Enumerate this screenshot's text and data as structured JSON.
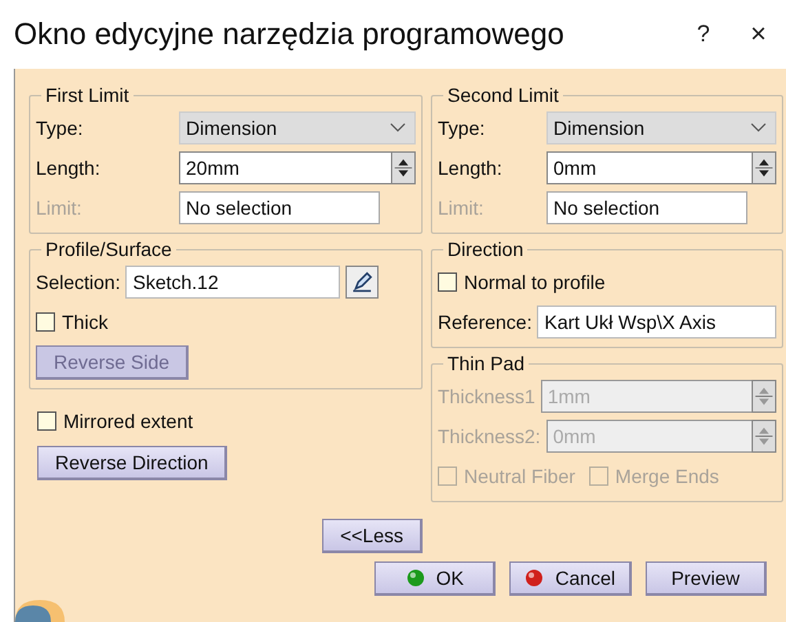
{
  "window": {
    "title": "Okno edycyjne narzędzia programowego",
    "help": "?",
    "close": "×"
  },
  "first_limit": {
    "title": "First Limit",
    "type_label": "Type:",
    "type_value": "Dimension",
    "length_label": "Length:",
    "length_value": "20mm",
    "limit_label": "Limit:",
    "limit_value": "No selection",
    "limit_disabled": true
  },
  "profile": {
    "title": "Profile/Surface",
    "selection_label": "Selection:",
    "selection_value": "Sketch.12",
    "thick": {
      "label": "Thick",
      "checked": false,
      "disabled": false
    },
    "reverse_side": {
      "label": "Reverse Side",
      "disabled": true
    }
  },
  "mirrored": {
    "label": "Mirrored extent",
    "checked": false,
    "disabled": false
  },
  "reverse_direction": {
    "label": "Reverse Direction",
    "disabled": false
  },
  "less": {
    "label": "<<Less"
  },
  "second_limit": {
    "title": "Second Limit",
    "type_label": "Type:",
    "type_value": "Dimension",
    "length_label": "Length:",
    "length_value": "0mm",
    "limit_label": "Limit:",
    "limit_value": "No selection",
    "limit_disabled": true
  },
  "direction": {
    "title": "Direction",
    "normal": {
      "label": "Normal to profile",
      "checked": false,
      "disabled": false
    },
    "reference_label": "Reference:",
    "reference_value": "Kart Ukł Wsp\\X Axis"
  },
  "thin_pad": {
    "title": "Thin Pad",
    "disabled": true,
    "thickness1_label": "Thickness1",
    "thickness1_value": "1mm",
    "thickness2_label": "Thickness2:",
    "thickness2_value": "0mm",
    "neutral": {
      "label": "Neutral Fiber",
      "checked": false,
      "disabled": true
    },
    "merge": {
      "label": "Merge Ends",
      "checked": false,
      "disabled": true
    }
  },
  "buttons": [
    {
      "label": "OK",
      "kind": "ok"
    },
    {
      "label": "Cancel",
      "kind": "cancel"
    },
    {
      "label": "Preview",
      "kind": "plain"
    }
  ]
}
